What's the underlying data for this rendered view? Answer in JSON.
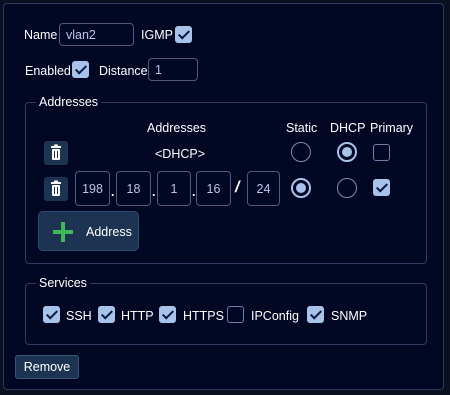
{
  "form": {
    "name_label": "Name",
    "name_value": "vlan2",
    "igmp_label": "IGMP",
    "igmp_checked": true,
    "enabled_label": "Enabled",
    "enabled_checked": true,
    "distance_label": "Distance",
    "distance_value": "1"
  },
  "addresses": {
    "group_title": "Addresses",
    "col_addresses": "Addresses",
    "col_static": "Static",
    "col_dhcp": "DHCP",
    "col_primary": "Primary",
    "rows": [
      {
        "text": "<DHCP>",
        "static": false,
        "dhcp": true,
        "primary": false
      },
      {
        "octets": [
          "198",
          "18",
          "1",
          "16"
        ],
        "prefix": "24",
        "static": true,
        "dhcp": false,
        "primary": true
      }
    ],
    "dot_sep": ".",
    "prefix_sep": "/",
    "add_button_label": "Address"
  },
  "services": {
    "group_title": "Services",
    "items": [
      {
        "label": "SSH",
        "checked": true
      },
      {
        "label": "HTTP",
        "checked": true
      },
      {
        "label": "HTTPS",
        "checked": true
      },
      {
        "label": "IPConfig",
        "checked": false
      },
      {
        "label": "SNMP",
        "checked": true
      }
    ]
  },
  "remove_button_label": "Remove",
  "colors": {
    "background": "#020724",
    "accent": "#a7c3ea",
    "button": "#1d3352",
    "plus_icon": "#3fb85a"
  },
  "icons": {
    "delete": "trash-icon",
    "add": "plus-icon",
    "check": "checkmark-icon"
  }
}
